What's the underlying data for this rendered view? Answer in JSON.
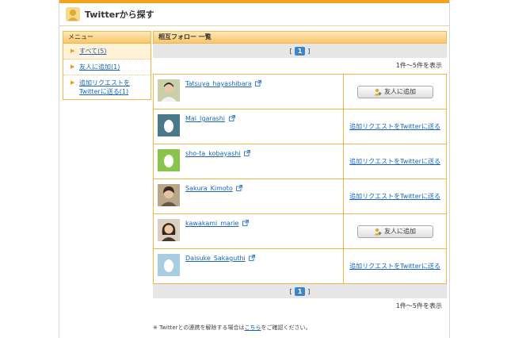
{
  "header": {
    "title": "Twitterから探す"
  },
  "sidebar": {
    "heading": "メニュー",
    "items": [
      {
        "label": "すべて(5)"
      },
      {
        "label": "友人に追加(1)"
      },
      {
        "label": "追加リクエストを\nTwitterに送る(1)"
      }
    ]
  },
  "main": {
    "heading": "相互フォロー 一覧",
    "pager": {
      "left": "[",
      "current": "1",
      "right": "]"
    },
    "count": "1件～5件を表示",
    "rows": [
      {
        "name": "Tatsuya_hayashibara",
        "action": "button",
        "action_label": "友人に追加"
      },
      {
        "name": "Mai_Igarashi",
        "action": "link",
        "action_label": "追加リクエストをTwitterに送る"
      },
      {
        "name": "sho-ta_kobayashi",
        "action": "link",
        "action_label": "追加リクエストをTwitterに送る"
      },
      {
        "name": "Sakura_Kimoto",
        "action": "link",
        "action_label": "追加リクエストをTwitterに送る"
      },
      {
        "name": "kawakami_marie",
        "action": "button",
        "action_label": "友人に追加"
      },
      {
        "name": "Daisuke_Sakaguthi",
        "action": "link",
        "action_label": "追加リクエストをTwitterに送る"
      }
    ]
  },
  "footer": {
    "note_before": "※ Twitterとの連携を解除する場合は",
    "note_link": "こちら",
    "note_after": "をご確認ください。"
  },
  "colors": {
    "accent": "#f4a21c",
    "link": "#1a66b3",
    "pager": "#3c86c8"
  }
}
